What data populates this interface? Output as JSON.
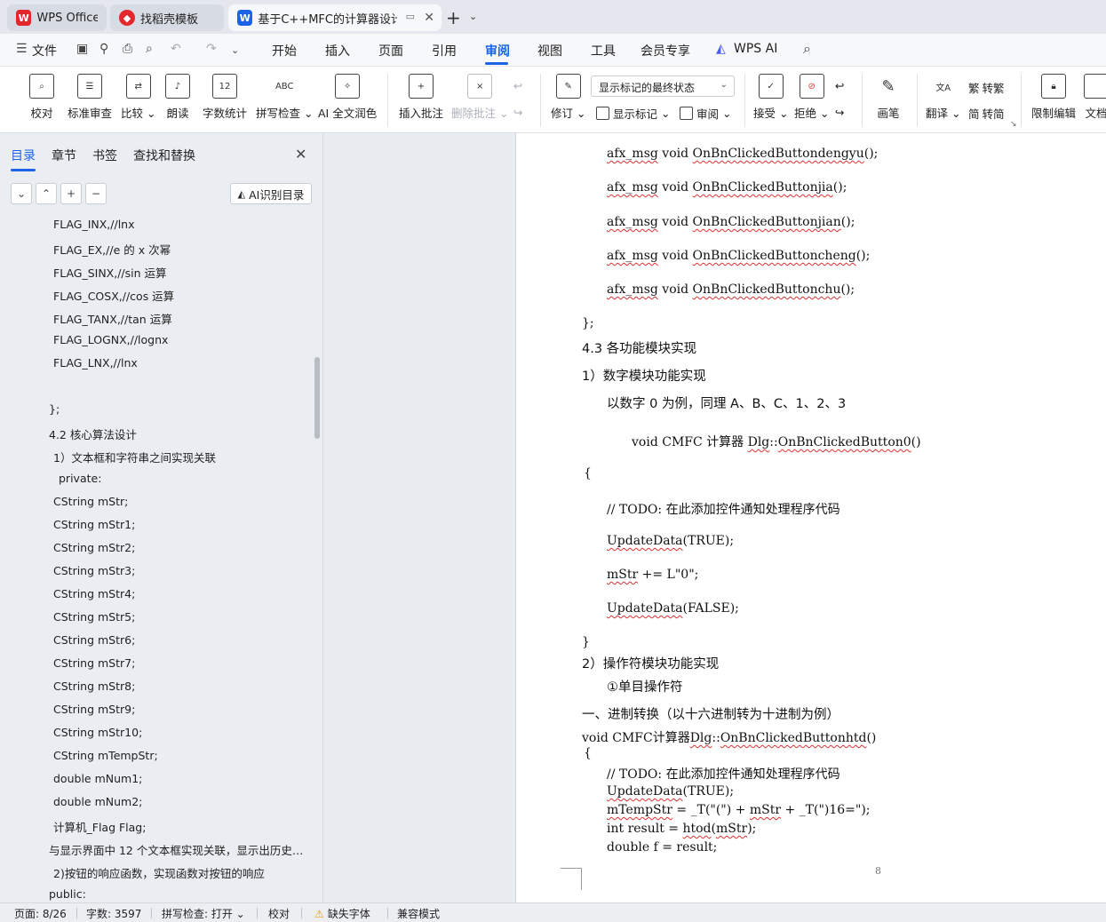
{
  "tabs": [
    {
      "label": "WPS Office",
      "icon": "wps-logo-icon",
      "active": false
    },
    {
      "label": "找稻壳模板",
      "icon": "docer-logo-icon",
      "active": false
    },
    {
      "label": "基于C++MFC的计算器设计",
      "icon": "word-doc-icon",
      "active": true
    }
  ],
  "menu": {
    "file": "文件",
    "items": [
      "开始",
      "插入",
      "页面",
      "引用",
      "审阅",
      "视图",
      "工具",
      "会员专享",
      "WPS AI"
    ],
    "active": "审阅"
  },
  "ribbon": {
    "proof": "校对",
    "standard_review": "标准审查",
    "compare": "比较",
    "read_aloud": "朗读",
    "word_count": "字数统计",
    "spell_check": "拼写检查",
    "ai_polish": "AI 全文润色",
    "insert_comment": "插入批注",
    "delete_comment": "删除批注",
    "track_changes": "修订",
    "markup_select": "显示标记的最终状态",
    "show_markup": "显示标记",
    "review_pane": "审阅",
    "accept": "接受",
    "reject": "拒绝",
    "ink": "画笔",
    "translate": "翻译",
    "to_traditional": "转繁",
    "to_simplified": "转简",
    "restrict_edit": "限制编辑",
    "doc_partial": "文档"
  },
  "nav": {
    "tabs": [
      "目录",
      "章节",
      "书签",
      "查找和替换"
    ],
    "active_tab": "目录",
    "ai_button": "AI识别目录",
    "items": [
      "FLAG_INX,//lnx",
      "FLAG_EX,//e 的 x 次幂",
      "FLAG_SINX,//sin 运算",
      "FLAG_COSX,//cos 运算",
      "FLAG_TANX,//tan 运算",
      "FLAG_LOGNX,//lognx",
      "FLAG_LNX,//lnx",
      "};",
      "4.2  核心算法设计",
      "1）文本框和字符串之间实现关联",
      "private:",
      "CString mStr;",
      "CString mStr1;",
      "CString mStr2;",
      "CString mStr3;",
      "CString mStr4;",
      "CString mStr5;",
      "CString mStr6;",
      "CString mStr7;",
      "CString mStr8;",
      "CString mStr9;",
      "CString mStr10;",
      "CString mTempStr;",
      "double mNum1;",
      "double mNum2;",
      "计算机_Flag Flag;",
      "与显示界面中 12 个文本框实现关联，显示出历史记...",
      "2)按钮的响应函数，实现函数对按钮的响应",
      "public:"
    ]
  },
  "doc": {
    "lines": [
      "afx_msg void OnBnClickedButtondengyu();",
      "afx_msg void OnBnClickedButtonjia();",
      "afx_msg void OnBnClickedButtonjian();",
      "afx_msg void OnBnClickedButtoncheng();",
      "afx_msg void OnBnClickedButtonchu();",
      "};",
      "4.3 各功能模块实现",
      "1）数字模块功能实现",
      "以数字 0 为例，同理 A、B、C、1、2、3",
      "void CMFC 计算器 Dlg::OnBnClickedButton0()",
      "{",
      "// TODO: 在此添加控件通知处理程序代码",
      "UpdateData(TRUE);",
      "mStr += L\"0\";",
      "UpdateData(FALSE);",
      "}",
      "2）操作符模块功能实现",
      "①单目操作符",
      "一、进制转换（以十六进制转为十进制为例）",
      "void CMFC计算器Dlg::OnBnClickedButtonhtd()",
      "{",
      "// TODO: 在此添加控件通知处理程序代码",
      "UpdateData(TRUE);",
      "mTempStr = _T(\"(\") + mStr + _T(\")16=\");",
      "int result = htod(mStr);",
      "double f = result;"
    ],
    "page_number": "8"
  },
  "status": {
    "page": "页面: 8/26",
    "words": "字数: 3597",
    "spell": "拼写检查: 打开",
    "proof": "校对",
    "missing_font": "缺失字体",
    "compat": "兼容模式"
  },
  "colors": {
    "accent": "#1d63e8",
    "wps_red": "#e3272d",
    "spell_error": "#e03131"
  }
}
